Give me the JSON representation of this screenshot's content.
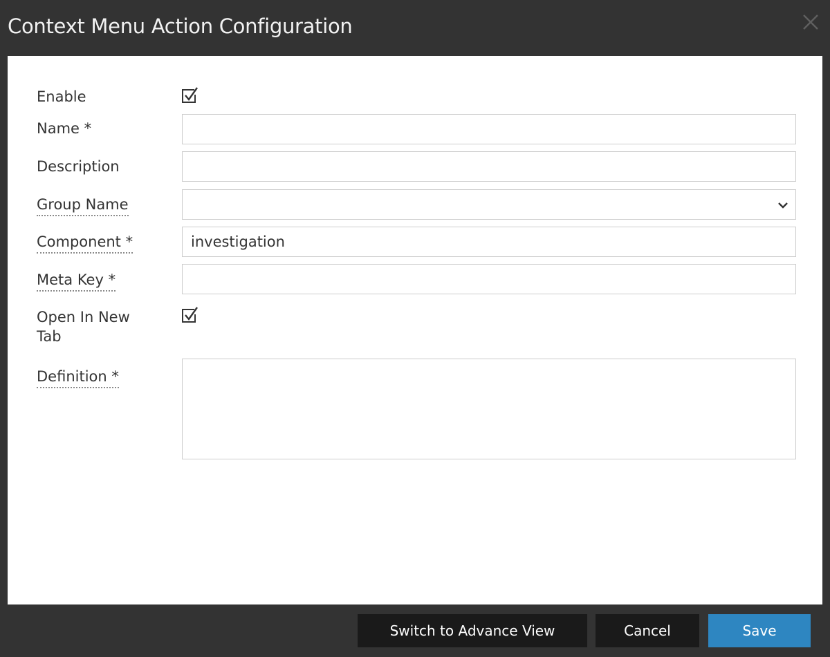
{
  "dialog": {
    "title": "Context Menu Action Configuration",
    "close_icon": "close-icon"
  },
  "form": {
    "enable": {
      "label": "Enable",
      "checked": true
    },
    "name": {
      "label": "Name *",
      "value": ""
    },
    "description": {
      "label": "Description",
      "value": ""
    },
    "group_name": {
      "label": "Group Name",
      "selected": ""
    },
    "component": {
      "label": "Component *",
      "value": "investigation"
    },
    "meta_key": {
      "label": "Meta Key *",
      "value": ""
    },
    "open_in_new_tab": {
      "label_line1": "Open In New",
      "label_line2": "Tab",
      "checked": true
    },
    "definition": {
      "label": "Definition *",
      "value": ""
    }
  },
  "footer": {
    "switch_label": "Switch to Advance View",
    "cancel_label": "Cancel",
    "save_label": "Save"
  },
  "colors": {
    "chrome": "#333333",
    "panel": "#ffffff",
    "dark_button": "#1a1a1a",
    "primary_button": "#2e86c1",
    "input_border": "#cccccc"
  }
}
